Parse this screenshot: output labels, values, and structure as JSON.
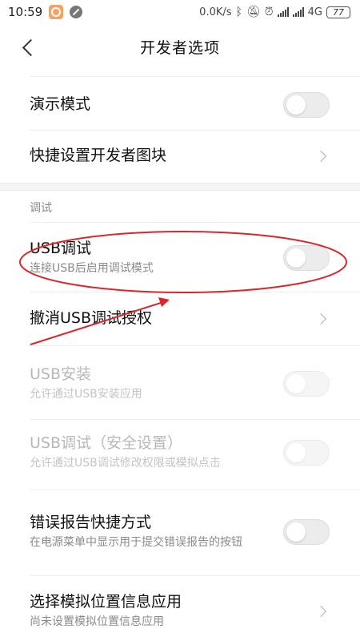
{
  "status_bar": {
    "time": "10:59",
    "net_speed": "0.0K/s",
    "network_type": "4G",
    "battery": "77",
    "icons": [
      "app-notification-icon",
      "blocked-icon",
      "bluetooth-icon",
      "mute-icon",
      "alarm-icon",
      "signal-icon",
      "signal-icon"
    ]
  },
  "header": {
    "title": "开发者选项",
    "back_icon": "back-arrow-icon"
  },
  "rows": {
    "demo_mode": {
      "title": "演示模式"
    },
    "quick_tiles": {
      "title": "快捷设置开发者图块"
    },
    "debug_section": {
      "header": "调试"
    },
    "usb_debugging": {
      "title": "USB调试",
      "subtitle": "连接USB后启用调试模式"
    },
    "revoke_usb": {
      "title": "撤消USB调试授权"
    },
    "usb_install": {
      "title": "USB安装",
      "subtitle": "允许通过USB安装应用"
    },
    "usb_debug_security": {
      "title": "USB调试（安全设置）",
      "subtitle": "允许通过USB调试修改权限或模拟点击"
    },
    "bug_report": {
      "title": "错误报告快捷方式",
      "subtitle": "在电源菜单中显示用于提交错误报告的按钮"
    },
    "mock_location": {
      "title": "选择模拟位置信息应用",
      "subtitle": "尚未设置模拟位置信息应用"
    }
  },
  "toggles": {
    "demo_mode": false,
    "usb_debugging": false,
    "usb_install": false,
    "usb_debug_security": false,
    "bug_report": false
  },
  "annotation_color": "#d9272e"
}
